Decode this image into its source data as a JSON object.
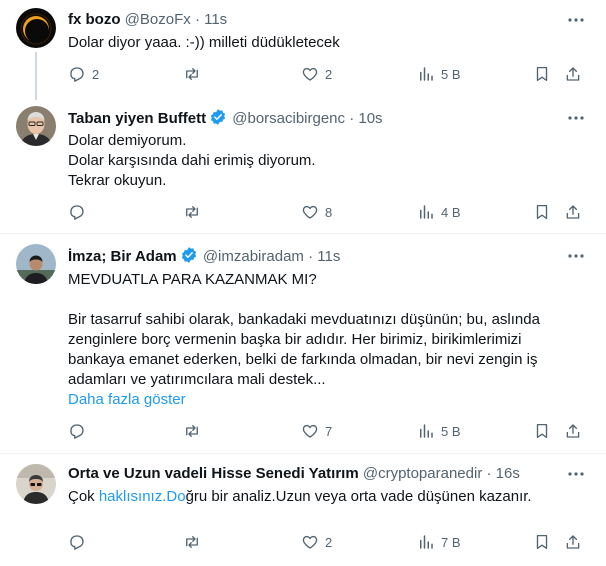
{
  "tweets": [
    {
      "name": "fx bozo",
      "handle": "@BozoFx",
      "separator": "·",
      "time": "11s",
      "lines": [
        "Dolar diyor yaaa. :-)) milleti düdükletecek"
      ],
      "replies": "2",
      "retweets": "",
      "likes": "2",
      "views": "5 B"
    },
    {
      "name": "Taban yiyen Buffett",
      "handle": "@borsacibirgenc",
      "separator": "·",
      "time": "10s",
      "lines": [
        "Dolar demiyorum.",
        "Dolar karşısında dahi erimiş diyorum.",
        "Tekrar okuyun."
      ],
      "replies": "",
      "retweets": "",
      "likes": "8",
      "views": "4 B"
    },
    {
      "name": "İmza; Bir Adam",
      "handle": "@imzabiradam",
      "separator": "·",
      "time": "11s",
      "lines": [
        "MEVDUATLA PARA KAZANMAK MI?",
        "",
        "Bir tasarruf sahibi olarak, bankadaki mevduatınızı düşünün; bu, aslında",
        "zenginlere borç vermenin başka bir adıdır. Her birimiz, birikimlerimizi",
        "bankaya emanet ederken, belki de farkında olmadan, bir nevi zengin iş",
        "adamları ve yatırımcılara mali destek..."
      ],
      "show_more": "Daha fazla göster",
      "replies": "",
      "retweets": "",
      "likes": "7",
      "views": "5 B"
    },
    {
      "name": "Orta ve Uzun vadeli Hisse Senedi Yatırım",
      "handle": "@cryptoparanedir",
      "separator": "·",
      "time": "16s",
      "text_pre": "Çok ",
      "text_link": "haklısınız.Do",
      "text_post": "ğru bir analiz.Uzun veya orta vade düşünen kazanır.",
      "replies": "",
      "retweets": "",
      "likes": "2",
      "views": "7 B"
    }
  ],
  "icons": {
    "reply": "reply-icon",
    "retweet": "retweet-icon",
    "like": "heart-icon",
    "views": "views-chart-icon",
    "bookmark": "bookmark-icon",
    "share": "share-icon",
    "more": "more-dots-icon",
    "verified": "verified-badge-icon"
  },
  "colors": {
    "text": "#0f1419",
    "secondary": "#536471",
    "link": "#1d9bf0",
    "divider": "#eff3f4",
    "thread_line": "#cfd9de"
  }
}
